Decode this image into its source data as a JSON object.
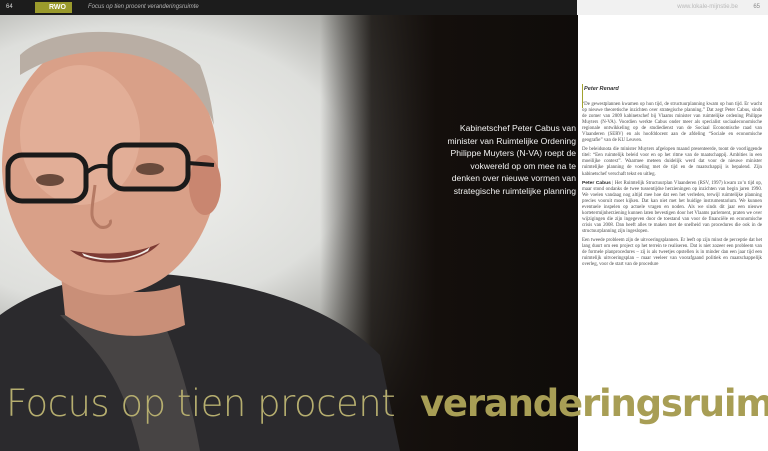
{
  "header": {
    "page_left": "64",
    "section_tag": "RWO",
    "running_head": "Focus op tien procent veranderingsruimte",
    "website": "www.lokale-mijnstie.be",
    "page_right": "65"
  },
  "pull_quote": "Kabinetschef Peter Cabus van minister van Ruimtelijke Ordening Philippe Muyters (N-VA) roept de vokwereld op om mee na te denken over nieuwe vormen van strategische ruimtelijke planning",
  "article": {
    "author": "Peter Renard",
    "paragraphs": [
      "“De gewestplannen kwamen op hun tijd, de structuurplanning kwam op hun tijd. Er wacht op nieuwe theoretische inzichten over strategische planning.” Dat zegt Peter Cabus, sinds de zomer van 2009 kabinetschef bij Vlaams minister van ruimtelijke ordening Philippe Muyters (N-VA). Voordien werkte Cabus onder meer als specialist sociaaleconomische regionale ontwikkeling op de studiedienst van de Sociaal Economische raad van Vlaanderen (SERV) en als hoofddocent aan de afdeling “Sociale en economische geografie” van de KU Leuven.",
      "De beleidsnota die minister Muyters afgelopen maand presenteerde, toont de voorliggende titel: “Een ruimtelijk beleid voor en op het ritme van de maatschappij. Ambities in een moeilijke context”. Waarmee meteen duidelijk werd dat voor de nieuwe minister ruimtelijke planning de voeling met de tijd en de maatschappij is bepalend. Zijn kabinetschef verschaft tekst en uitleg.",
      "Het Ruimtelijk Structuurplan Vlaanderen (RSV, 1997) kwam zo’n tijd op, maar stond ondanks de twee tussentijdse herzieningen op inzichten van begin jaren 1990. We voelen vandaag nog altijd mee hoe dat een het verleden, terwijl ruimtelijke planning precies vooruit moet kijken. Dat kan niet met het huidige instrumentarium. We kunnen eventuele inspelen op actuele vragen en noden. Als we sinds dit jaar een nieuwe kortetermijnherziening kunnen laten bevestigen door het Vlaams parlement, praten we over wijzigingen die zijn ingegeven door de toestand van voor de financiële en economische crisis van 2008. Dan heeft alles te maken met de snelheid van procedures die ook in de structuurplanning zijn ingeslopen.",
      "Een tweede probleem zijn de uitvoeringsplannen. Er leeft op zijn minst de perceptie dat het lang duurt om een project op het terrein te realiseren. Dat is niet zozeer een probleem van de formele planprocedures – zij is als tweetjes opstellen is in minder dan een jaar tijd een ruimtelijk uitvoeringsplan – maar veeleer van voorafgaand politiek en maatschappelijk overleg, voor de start van de procedure"
    ],
    "lead_label": "Peter Cabus"
  },
  "headline": {
    "part1": "Focus op tien procent",
    "part2": "veranderingsruimte"
  },
  "colors": {
    "accent_olive": "#9a9a2c",
    "headline_light": "#b6ae6f",
    "headline_bold": "#a89e55"
  }
}
